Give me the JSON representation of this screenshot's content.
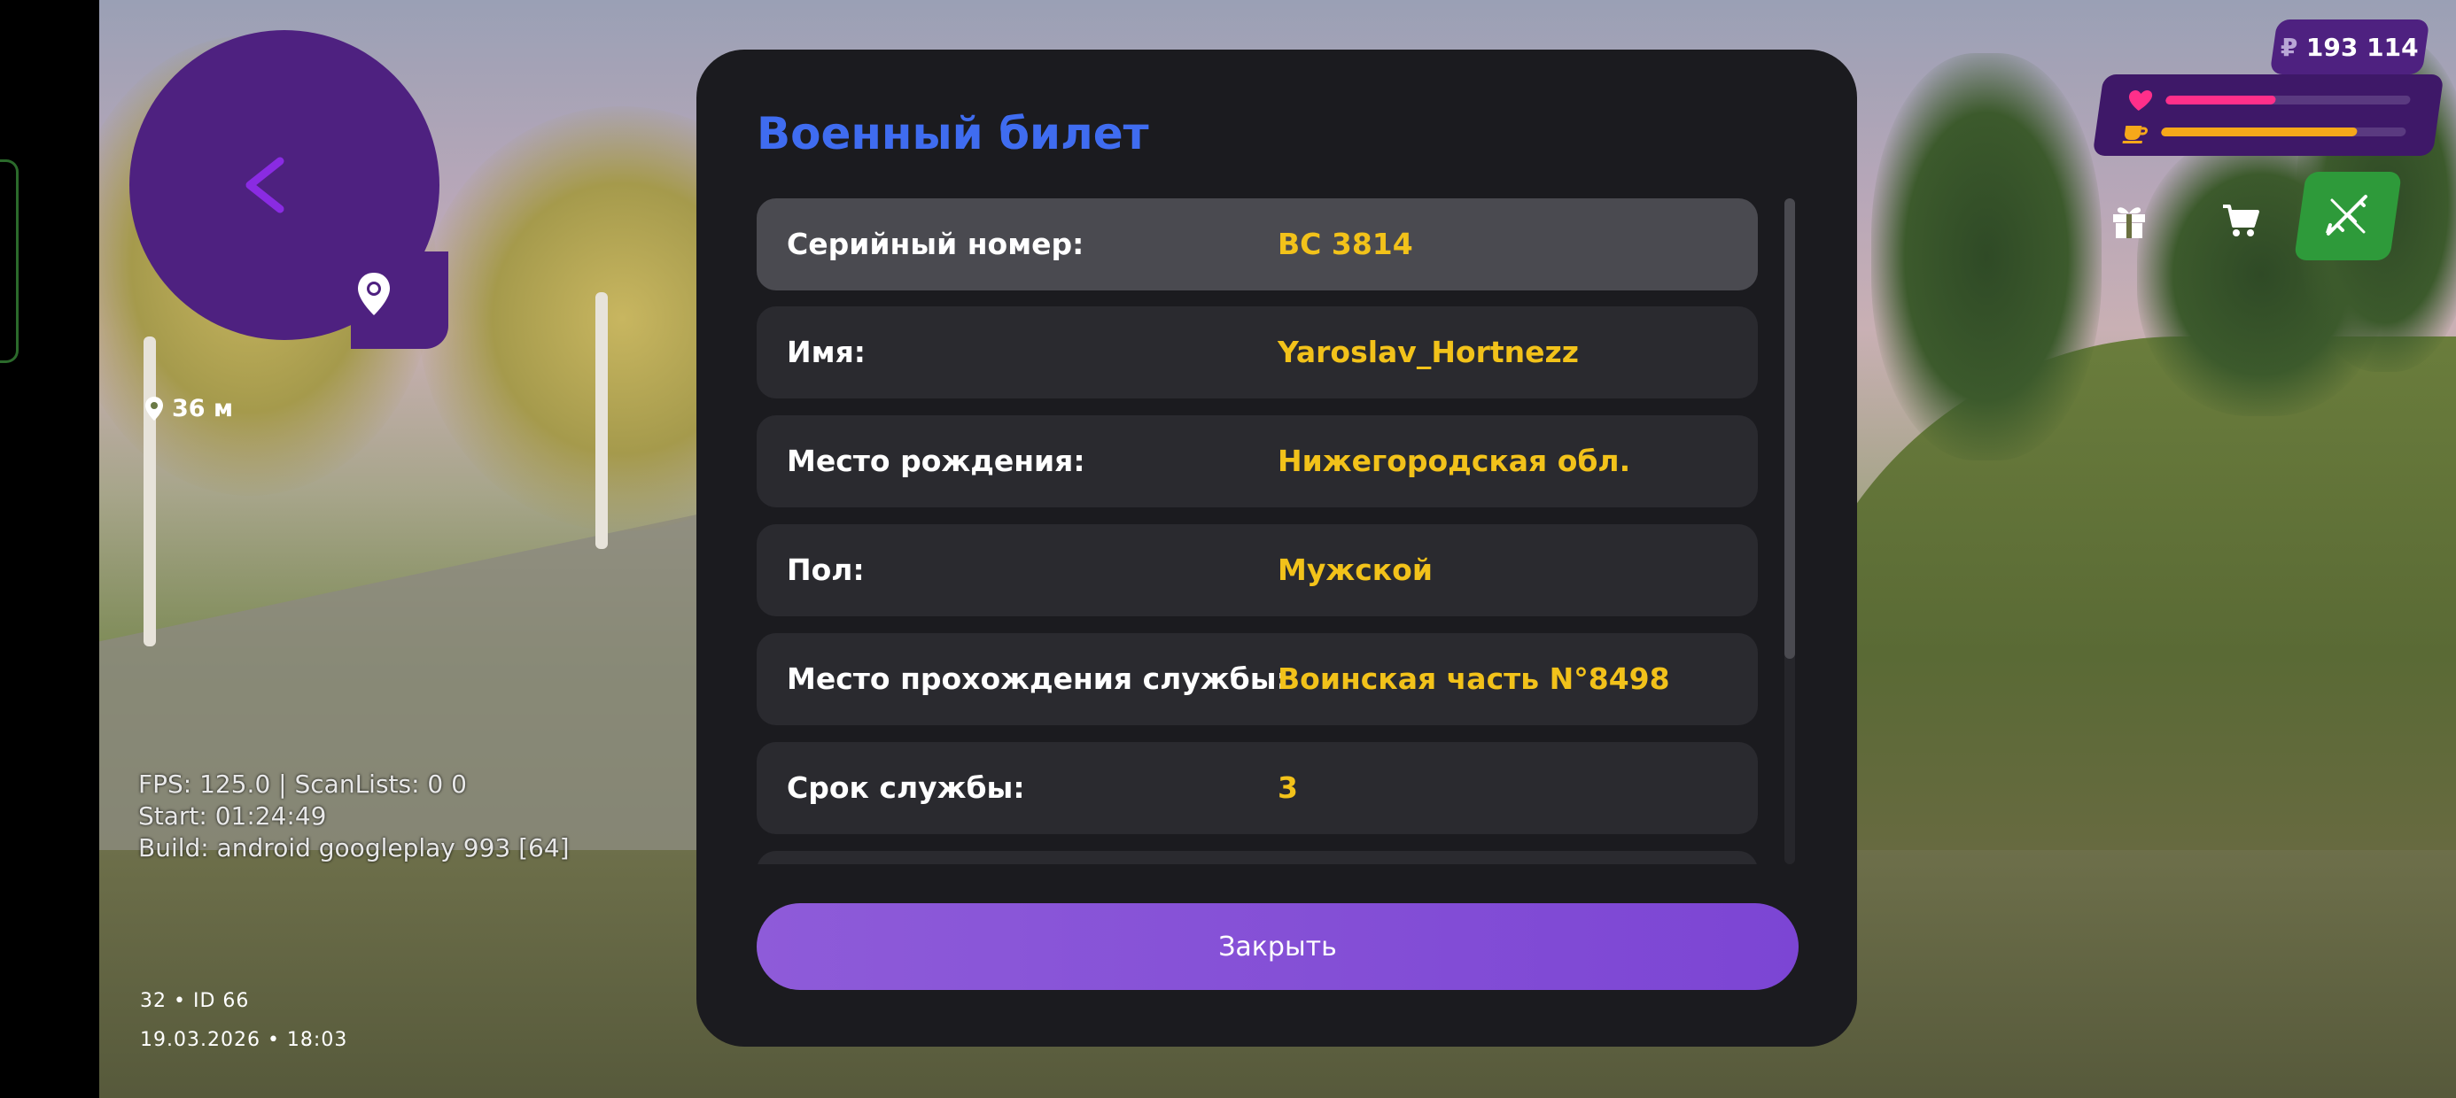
{
  "minimap": {
    "back_icon": "chevron-left-icon",
    "pin_icon": "map-pin-icon",
    "distance": "36 м"
  },
  "debug": {
    "fps": "FPS: 125.0 | ScanLists: 0 0",
    "start": "Start: 01:24:49",
    "build": "Build: android googleplay 993 [64]"
  },
  "meta": {
    "server": "32 • ID 66",
    "datetime": "19.03.2026 • 18:03"
  },
  "hud": {
    "currency_symbol": "₽",
    "money": "193 114",
    "health_fraction": 0.45,
    "hunger_fraction": 0.8,
    "health_color": "#ff2f8a",
    "hunger_color": "#f6a81a",
    "gift_icon": "gift-icon",
    "cart_icon": "shopping-cart-icon",
    "weapon_icon": "rifle-icon"
  },
  "modal": {
    "title": "Военный билет",
    "title_color": "#3f6cf0",
    "value_color": "#f2c21a",
    "rows": [
      {
        "label": "Серийный номер:",
        "value": "BC 3814"
      },
      {
        "label": "Имя:",
        "value": "Yaroslav_Hortnezz"
      },
      {
        "label": "Место рождения:",
        "value": "Нижегородская обл."
      },
      {
        "label": "Пол:",
        "value": "Мужской"
      },
      {
        "label": "Место прохождения службы:",
        "value": "Воинская часть N°8498"
      },
      {
        "label": "Срок службы:",
        "value": "3"
      },
      {
        "label": "",
        "value": ""
      }
    ],
    "close_label": "Закрыть"
  }
}
